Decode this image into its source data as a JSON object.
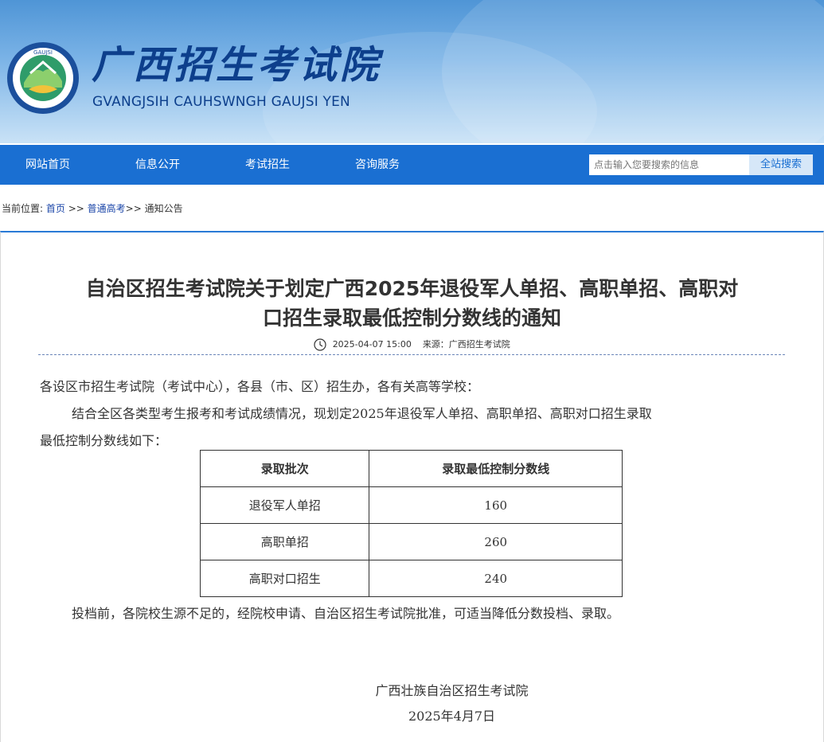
{
  "header": {
    "title_cn": "广西招生考试院",
    "title_en": "GVANGJSIH CAUHSWNGH GAUJSI YEN",
    "logo_ring_text": "广西招生考试院 GVANGJSIH CAUHSWNGH GAUJSI YEN"
  },
  "nav": {
    "items": [
      "网站首页",
      "信息公开",
      "考试招生",
      "咨询服务"
    ],
    "search_placeholder": "点击输入您要搜索的信息",
    "search_button": "全站搜索"
  },
  "breadcrumb": {
    "prefix": "当前位置:",
    "home": "首页",
    "sep1": " >> ",
    "section": "普通高考",
    "sep2": ">> ",
    "current": "通知公告"
  },
  "article": {
    "title_line1": "自治区招生考试院关于划定广西2025年退役军人单招、高职单招、高职对",
    "title_line2": "口招生录取最低控制分数线的通知",
    "datetime": "2025-04-07 15:00",
    "source": "来源：广西招生考试院",
    "salutation": "各设区市招生考试院（考试中心），各县（市、区）招生办，各有关高等学校：",
    "intro_line1": "结合全区各类型考生报考和考试成绩情况，现划定2025年退役军人单招、高职单招、高职对口招生录取",
    "intro_line2": "最低控制分数线如下：",
    "table": {
      "headers": [
        "录取批次",
        "录取最低控制分数线"
      ],
      "rows": [
        [
          "退役军人单招",
          "160"
        ],
        [
          "高职单招",
          "260"
        ],
        [
          "高职对口招生",
          "240"
        ]
      ]
    },
    "note": "投档前，各院校生源不足的，经院校申请、自治区招生考试院批准，可适当降低分数投档、录取。",
    "signature_org": "广西壮族自治区招生考试院",
    "signature_date": "2025年4月7日"
  },
  "colors": {
    "nav_bg": "#1a6fd2",
    "title_color": "#0d3f8c",
    "link": "#1a45a8"
  }
}
